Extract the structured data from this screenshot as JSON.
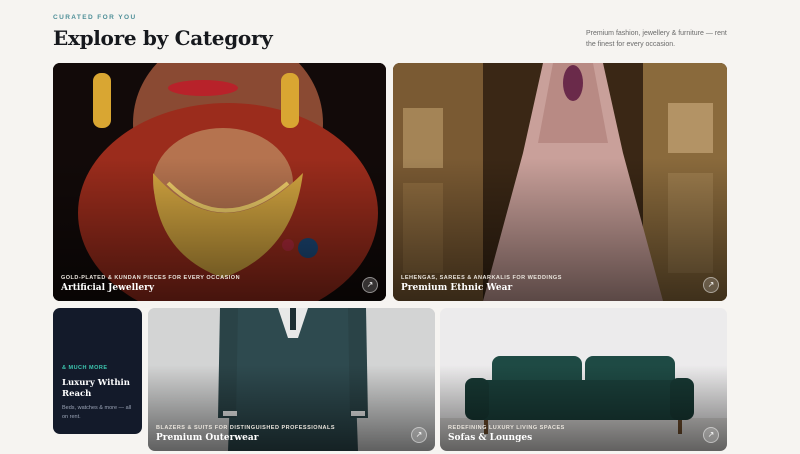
{
  "header": {
    "eyebrow": "CURATED FOR YOU",
    "title": "Explore by Category",
    "tagline": "Premium fashion, jewellery & furniture — rent the finest for every occasion."
  },
  "categories": [
    {
      "subtitle": "GOLD-PLATED & KUNDAN PIECES FOR EVERY OCCASION",
      "name": "Artificial Jewellery",
      "arrow_icon": "arrow-up-right-icon"
    },
    {
      "subtitle": "LEHENGAS, SAREES & ANARKALIS FOR WEDDINGS",
      "name": "Premium Ethnic Wear",
      "arrow_icon": "arrow-up-right-icon"
    },
    {
      "subtitle": "BLAZERS & SUITS FOR DISTINGUISHED PROFESSIONALS",
      "name": "Premium Outerwear",
      "arrow_icon": "arrow-up-right-icon"
    },
    {
      "subtitle": "REDEFINING LUXURY LIVING SPACES",
      "name": "Sofas & Lounges",
      "arrow_icon": "arrow-up-right-icon"
    }
  ],
  "luxury": {
    "tag": "& MUCH MORE",
    "title": "Luxury Within Reach",
    "description": "Beds, watches & more — all on rent."
  },
  "colors": {
    "accent": "#4f8f98",
    "luxury_bg": "#131a2a",
    "luxury_tag": "#3cc7b0"
  }
}
